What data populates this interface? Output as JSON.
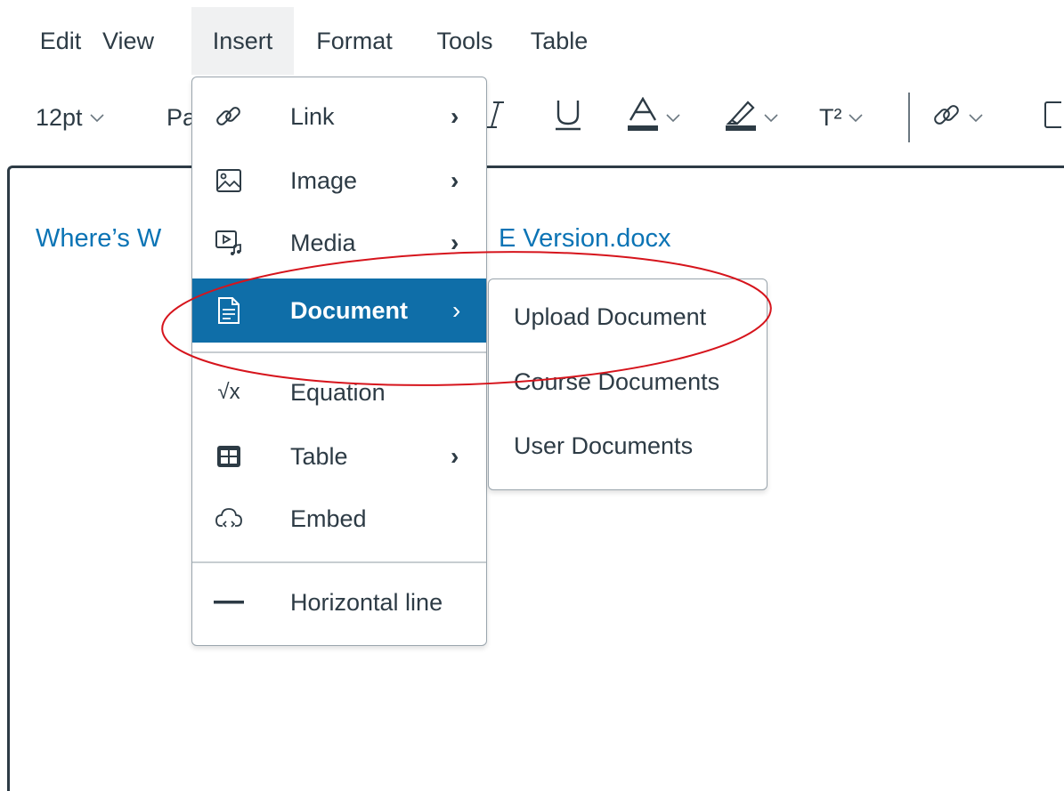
{
  "menubar": {
    "items": [
      {
        "label": "Edit"
      },
      {
        "label": "View"
      },
      {
        "label": "Insert"
      },
      {
        "label": "Format"
      },
      {
        "label": "Tools"
      },
      {
        "label": "Table"
      }
    ]
  },
  "toolbar": {
    "font_size": "12pt",
    "paragraph_partial": "Pa",
    "superscript_label": "T²"
  },
  "editor": {
    "link_left": "Where’s W",
    "link_right": "E Version.docx"
  },
  "insert_menu": {
    "items": [
      {
        "label": "Link",
        "icon": "link-icon",
        "has_submenu": true
      },
      {
        "label": "Image",
        "icon": "image-icon",
        "has_submenu": true
      },
      {
        "label": "Media",
        "icon": "media-icon",
        "has_submenu": true
      },
      {
        "label": "Document",
        "icon": "document-icon",
        "has_submenu": true,
        "selected": true
      },
      {
        "label": "Equation",
        "icon": "equation-icon",
        "has_submenu": false
      },
      {
        "label": "Table",
        "icon": "table-icon",
        "has_submenu": true
      },
      {
        "label": "Embed",
        "icon": "embed-icon",
        "has_submenu": false
      },
      {
        "label": "Horizontal line",
        "icon": "horizontal-line-icon",
        "has_submenu": false
      }
    ],
    "equation_glyph": "√x"
  },
  "document_submenu": {
    "items": [
      {
        "label": "Upload Document"
      },
      {
        "label": "Course Documents"
      },
      {
        "label": "User Documents"
      }
    ]
  },
  "colors": {
    "selected_bg": "#0f6ea8",
    "link": "#0b74b5",
    "annotation": "#d6141c",
    "text": "#2d3b45"
  }
}
